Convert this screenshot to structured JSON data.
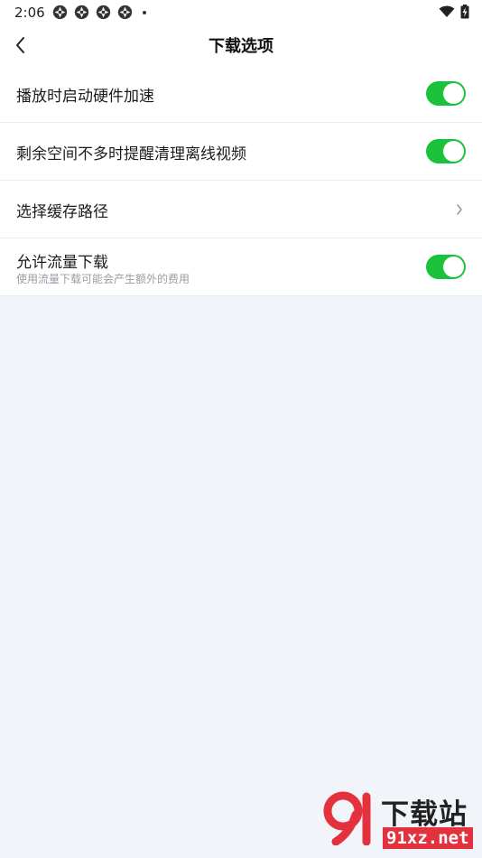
{
  "status_bar": {
    "time": "2:06",
    "notification_icons": [
      "app-notification-icon",
      "app-notification-icon",
      "app-notification-icon",
      "app-notification-icon"
    ],
    "right_icons": [
      "wifi-icon",
      "battery-charging-icon"
    ]
  },
  "header": {
    "back_icon": "chevron-left-icon",
    "title": "下载选项"
  },
  "settings": {
    "items": [
      {
        "label": "播放时启动硬件加速",
        "control": "toggle",
        "on": true
      },
      {
        "label": "剩余空间不多时提醒清理离线视频",
        "control": "toggle",
        "on": true
      },
      {
        "label": "选择缓存路径",
        "control": "chevron",
        "icon": "chevron-right-icon"
      },
      {
        "label": "允许流量下载",
        "sublabel": "使用流量下载可能会产生额外的费用",
        "control": "toggle",
        "on": true
      }
    ]
  },
  "colors": {
    "toggle_on": "#19c23a",
    "page_background": "#f1f4f9",
    "watermark_red": "#e3323d"
  },
  "watermark": {
    "brand": "下载站",
    "domain": "91xz.net",
    "logo_icon": "91-logo-icon"
  }
}
